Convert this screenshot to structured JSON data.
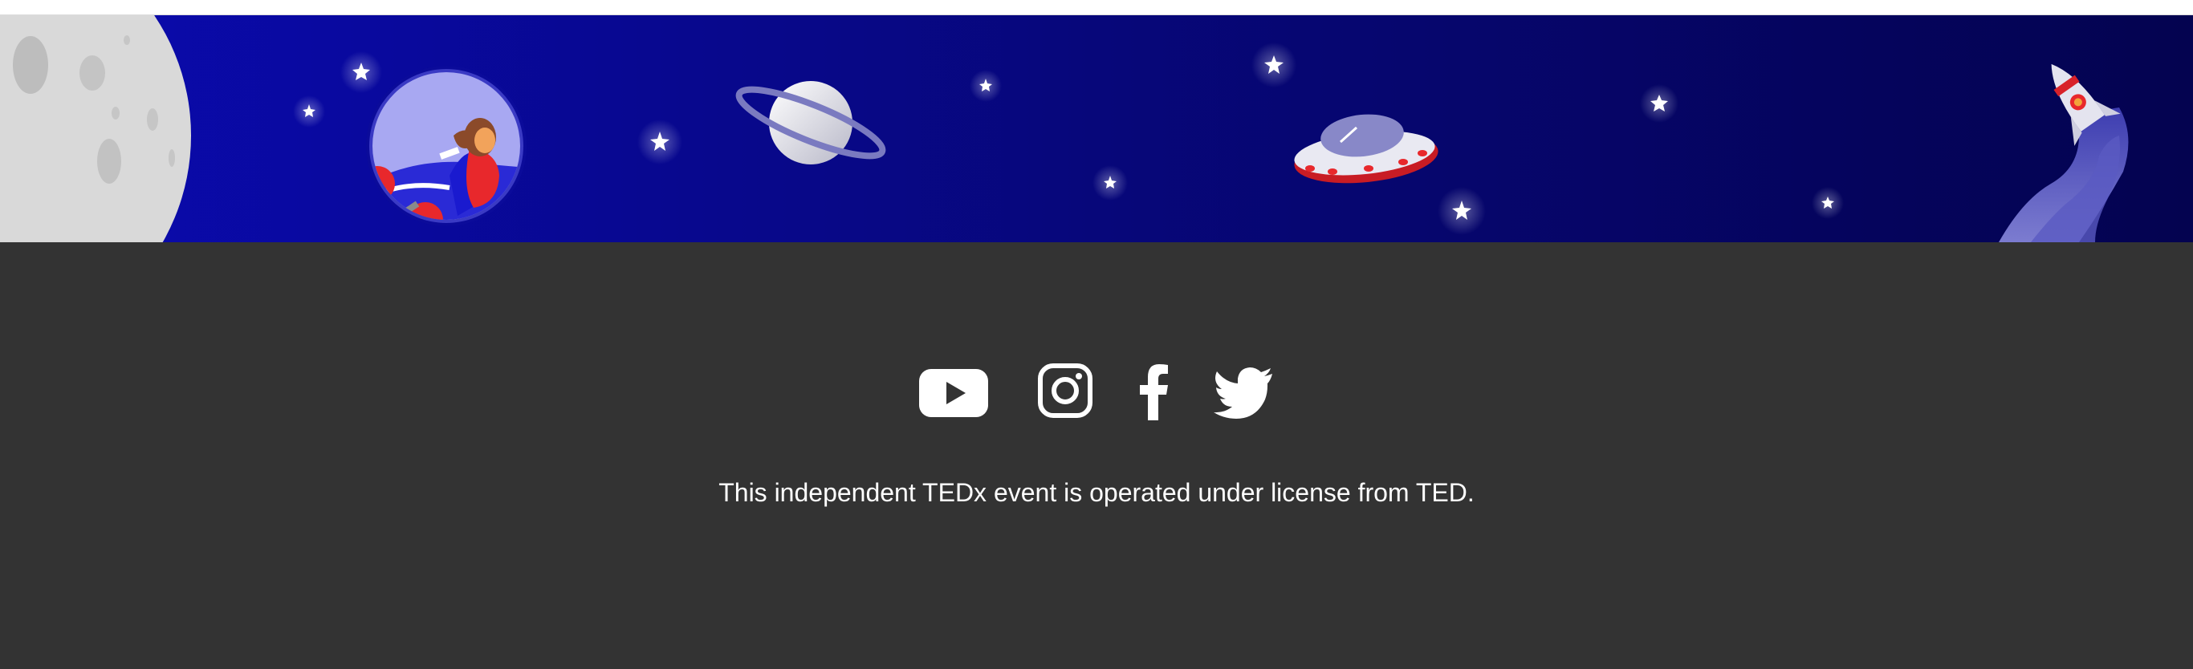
{
  "banner": {
    "sky_colors": [
      "#0a0aa8",
      "#07066a",
      "#04034a"
    ],
    "illustrations": [
      "moon-icon",
      "astronaut-porthole-icon",
      "planet-saturn-icon",
      "ufo-icon",
      "rocket-icon",
      "star-icon"
    ]
  },
  "footer": {
    "background": "#333333",
    "social_links": [
      {
        "icon": "youtube-icon",
        "label": "YouTube"
      },
      {
        "icon": "instagram-icon",
        "label": "Instagram"
      },
      {
        "icon": "facebook-icon",
        "label": "Facebook"
      },
      {
        "icon": "twitter-icon",
        "label": "Twitter"
      }
    ],
    "license_text": "This independent TEDx event is operated under license from TED."
  }
}
